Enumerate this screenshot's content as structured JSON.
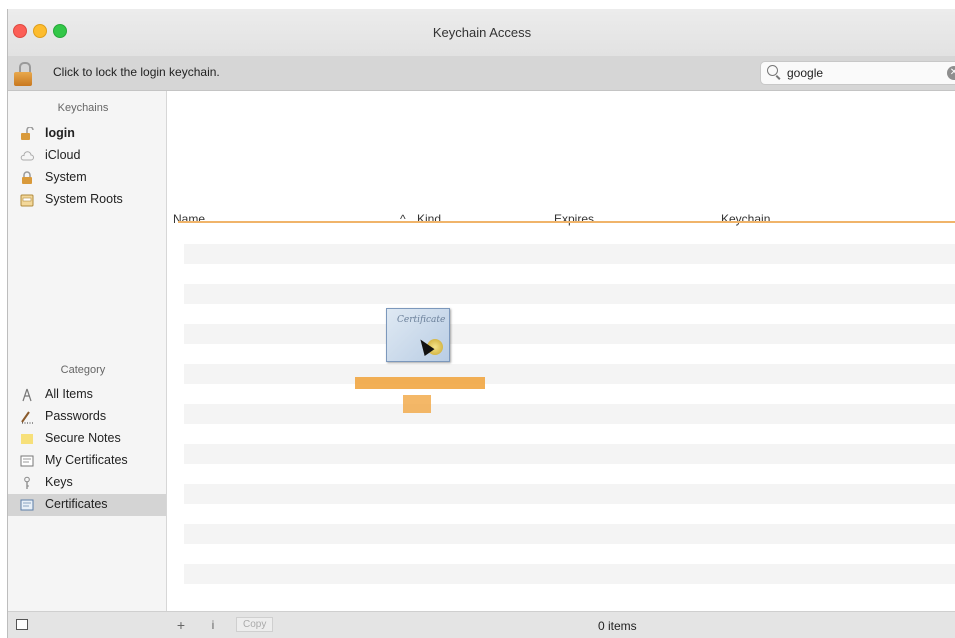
{
  "window": {
    "title": "Keychain Access"
  },
  "toolbar": {
    "lock_text": "Click to lock the login keychain.",
    "search_value": "google"
  },
  "sidebar": {
    "keychains_heading": "Keychains",
    "keychains": [
      {
        "label": "login",
        "icon": "unlocked-padlock-icon",
        "bold": true
      },
      {
        "label": "iCloud",
        "icon": "cloud-icon"
      },
      {
        "label": "System",
        "icon": "padlock-icon"
      },
      {
        "label": "System Roots",
        "icon": "cabinet-icon"
      }
    ],
    "category_heading": "Category",
    "categories": [
      {
        "label": "All Items",
        "icon": "all-items-icon"
      },
      {
        "label": "Passwords",
        "icon": "pencil-icon"
      },
      {
        "label": "Secure Notes",
        "icon": "note-icon"
      },
      {
        "label": "My Certificates",
        "icon": "certificate-icon"
      },
      {
        "label": "Keys",
        "icon": "key-icon"
      },
      {
        "label": "Certificates",
        "icon": "certificate-icon",
        "selected": true
      }
    ]
  },
  "table": {
    "columns": [
      "Name",
      "Kind",
      "Expires",
      "Keychain"
    ],
    "sort_indicator": "^"
  },
  "drag_item": {
    "text": "Certificate"
  },
  "statusbar": {
    "add_label": "+",
    "info_label": "i",
    "copy_label": "Copy",
    "item_count": "0 items"
  },
  "colors": {
    "accent_sort_line": "#f0b46a",
    "selection": "#d4d4d4"
  }
}
